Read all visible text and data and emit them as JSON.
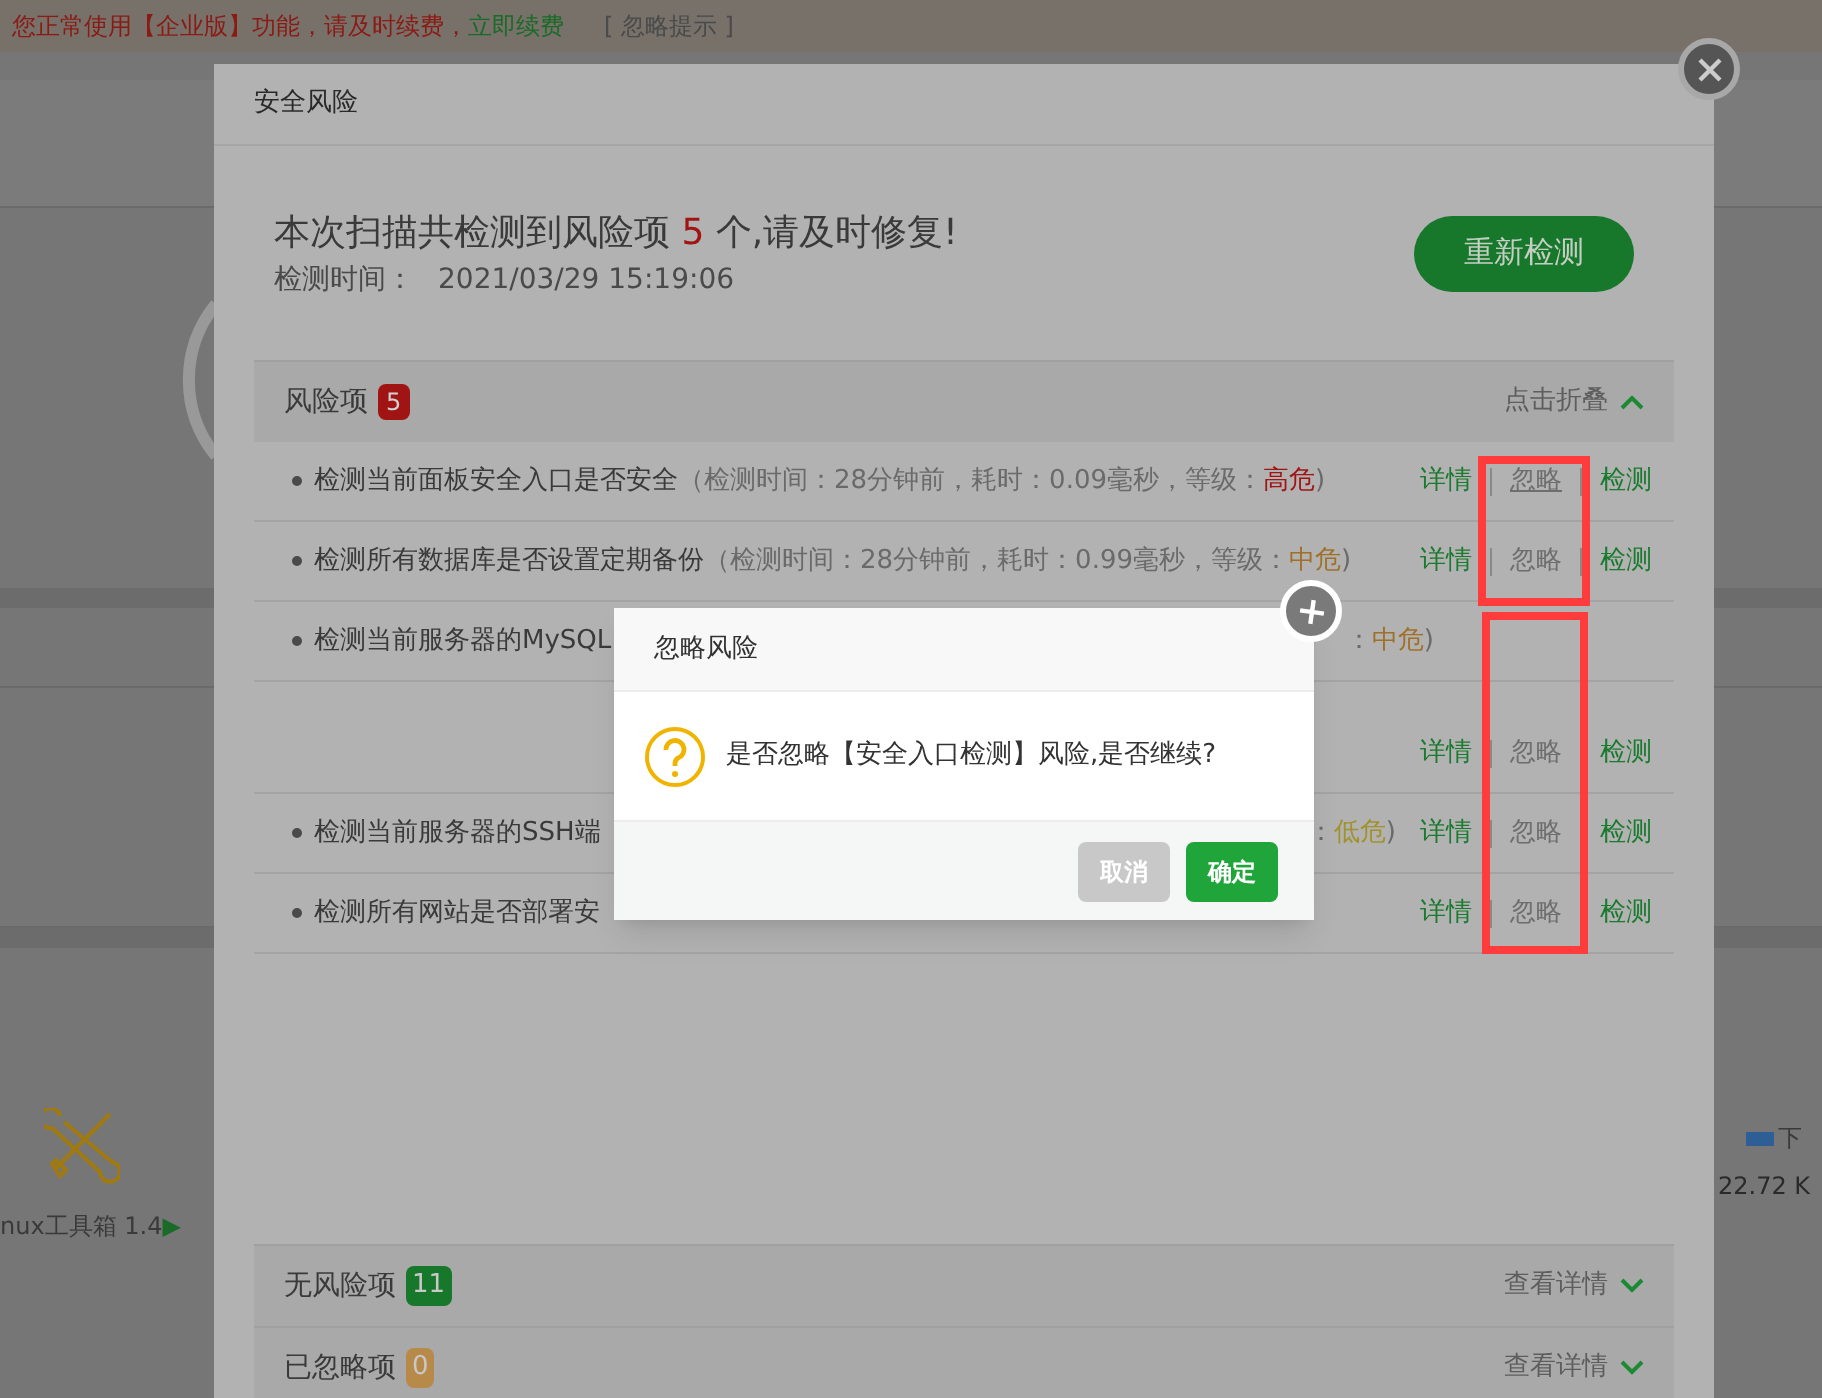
{
  "banner": {
    "notice": "您正常使用【企业版】功能，请及时续费，",
    "renew_link": "立即续费",
    "dismiss_link": "[ 忽略提示 ]"
  },
  "background": {
    "tool_label": "nux工具箱 1.4",
    "tool_arrow": "▶",
    "legend": {
      "label": "下",
      "color": "#2d5f96"
    },
    "speed": "22.72 K"
  },
  "modal": {
    "title": "安全风险",
    "summary_prefix": "本次扫描共检测到风险项 ",
    "summary_count": "5",
    "summary_suffix": " 个,请及时修复!",
    "time_label": "检测时间：",
    "time_value": "2021/03/29 15:19:06",
    "rescan_button": "重新检测",
    "risk_section": {
      "label": "风险项",
      "count": "5",
      "toggle": "点击折叠",
      "expanded": true
    },
    "rows": [
      {
        "title": "检测当前面板安全入口是否安全",
        "meta": "（检测时间：28分钟前，耗时：0.09毫秒，等级：",
        "level": "高危",
        "close": ")",
        "color": "#a01414",
        "actions": [
          {
            "label": "详情",
            "kind": "link",
            "hovered": false
          },
          {
            "label": "忽略",
            "kind": "muted",
            "hovered": true
          },
          {
            "label": "检测",
            "kind": "link",
            "hovered": false
          }
        ]
      },
      {
        "title": "检测所有数据库是否设置定期备份",
        "meta": "（检测时间：28分钟前，耗时：0.99毫秒，等级：",
        "level": "中危",
        "close": ")",
        "color": "#a0702a",
        "actions": [
          {
            "label": "详情",
            "kind": "link",
            "hovered": false
          },
          {
            "label": "忽略",
            "kind": "muted",
            "hovered": false
          },
          {
            "label": "检测",
            "kind": "link",
            "hovered": false
          }
        ]
      },
      {
        "title": "检测当前服务器的MySQL",
        "tail": "：",
        "level": "中危",
        "close": ")",
        "color": "#a0702a"
      },
      {
        "actions": [
          {
            "label": "详情",
            "kind": "link",
            "hovered": false
          },
          {
            "label": "忽略",
            "kind": "muted",
            "hovered": false
          },
          {
            "label": "检测",
            "kind": "link",
            "hovered": false
          }
        ]
      },
      {
        "title": "检测当前服务器的SSH端",
        "tail": "：",
        "level": "低危",
        "close": ")",
        "color": "#a0922e",
        "actions": [
          {
            "label": "详情",
            "kind": "link",
            "hovered": false
          },
          {
            "label": "忽略",
            "kind": "muted",
            "hovered": false
          },
          {
            "label": "检测",
            "kind": "link",
            "hovered": false
          }
        ]
      },
      {
        "title": "检测所有网站是否部署安",
        "actions": [
          {
            "label": "详情",
            "kind": "link",
            "hovered": false
          },
          {
            "label": "忽略",
            "kind": "muted",
            "hovered": false
          },
          {
            "label": "检测",
            "kind": "link",
            "hovered": false
          }
        ]
      }
    ],
    "footer_sections": [
      {
        "label": "无风险项",
        "count": "11",
        "color": "#17772a",
        "toggle": "查看详情"
      },
      {
        "label": "已忽略项",
        "count": "0",
        "color": "#b88a4a",
        "toggle": "查看详情"
      }
    ]
  },
  "confirm": {
    "title": "忽略风险",
    "message": "是否忽略【安全入口检测】风险,是否继续?",
    "buttons": [
      {
        "label": "取消",
        "kind": "secondary"
      },
      {
        "label": "确定",
        "kind": "primary"
      }
    ]
  }
}
